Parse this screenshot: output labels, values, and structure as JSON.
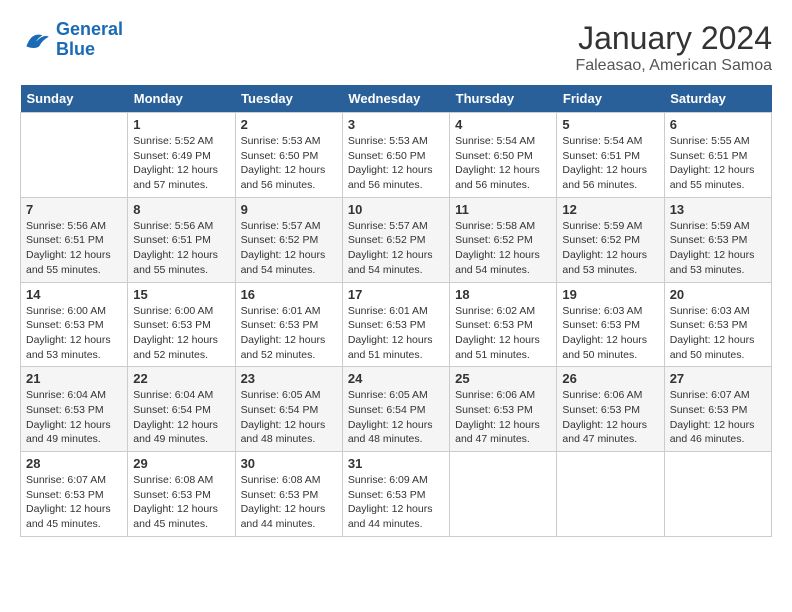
{
  "header": {
    "logo_line1": "General",
    "logo_line2": "Blue",
    "month": "January 2024",
    "location": "Faleasao, American Samoa"
  },
  "days_of_week": [
    "Sunday",
    "Monday",
    "Tuesday",
    "Wednesday",
    "Thursday",
    "Friday",
    "Saturday"
  ],
  "weeks": [
    [
      {
        "day": "",
        "sunrise": "",
        "sunset": "",
        "daylight": ""
      },
      {
        "day": "1",
        "sunrise": "Sunrise: 5:52 AM",
        "sunset": "Sunset: 6:49 PM",
        "daylight": "Daylight: 12 hours and 57 minutes."
      },
      {
        "day": "2",
        "sunrise": "Sunrise: 5:53 AM",
        "sunset": "Sunset: 6:50 PM",
        "daylight": "Daylight: 12 hours and 56 minutes."
      },
      {
        "day": "3",
        "sunrise": "Sunrise: 5:53 AM",
        "sunset": "Sunset: 6:50 PM",
        "daylight": "Daylight: 12 hours and 56 minutes."
      },
      {
        "day": "4",
        "sunrise": "Sunrise: 5:54 AM",
        "sunset": "Sunset: 6:50 PM",
        "daylight": "Daylight: 12 hours and 56 minutes."
      },
      {
        "day": "5",
        "sunrise": "Sunrise: 5:54 AM",
        "sunset": "Sunset: 6:51 PM",
        "daylight": "Daylight: 12 hours and 56 minutes."
      },
      {
        "day": "6",
        "sunrise": "Sunrise: 5:55 AM",
        "sunset": "Sunset: 6:51 PM",
        "daylight": "Daylight: 12 hours and 55 minutes."
      }
    ],
    [
      {
        "day": "7",
        "sunrise": "Sunrise: 5:56 AM",
        "sunset": "Sunset: 6:51 PM",
        "daylight": "Daylight: 12 hours and 55 minutes."
      },
      {
        "day": "8",
        "sunrise": "Sunrise: 5:56 AM",
        "sunset": "Sunset: 6:51 PM",
        "daylight": "Daylight: 12 hours and 55 minutes."
      },
      {
        "day": "9",
        "sunrise": "Sunrise: 5:57 AM",
        "sunset": "Sunset: 6:52 PM",
        "daylight": "Daylight: 12 hours and 54 minutes."
      },
      {
        "day": "10",
        "sunrise": "Sunrise: 5:57 AM",
        "sunset": "Sunset: 6:52 PM",
        "daylight": "Daylight: 12 hours and 54 minutes."
      },
      {
        "day": "11",
        "sunrise": "Sunrise: 5:58 AM",
        "sunset": "Sunset: 6:52 PM",
        "daylight": "Daylight: 12 hours and 54 minutes."
      },
      {
        "day": "12",
        "sunrise": "Sunrise: 5:59 AM",
        "sunset": "Sunset: 6:52 PM",
        "daylight": "Daylight: 12 hours and 53 minutes."
      },
      {
        "day": "13",
        "sunrise": "Sunrise: 5:59 AM",
        "sunset": "Sunset: 6:53 PM",
        "daylight": "Daylight: 12 hours and 53 minutes."
      }
    ],
    [
      {
        "day": "14",
        "sunrise": "Sunrise: 6:00 AM",
        "sunset": "Sunset: 6:53 PM",
        "daylight": "Daylight: 12 hours and 53 minutes."
      },
      {
        "day": "15",
        "sunrise": "Sunrise: 6:00 AM",
        "sunset": "Sunset: 6:53 PM",
        "daylight": "Daylight: 12 hours and 52 minutes."
      },
      {
        "day": "16",
        "sunrise": "Sunrise: 6:01 AM",
        "sunset": "Sunset: 6:53 PM",
        "daylight": "Daylight: 12 hours and 52 minutes."
      },
      {
        "day": "17",
        "sunrise": "Sunrise: 6:01 AM",
        "sunset": "Sunset: 6:53 PM",
        "daylight": "Daylight: 12 hours and 51 minutes."
      },
      {
        "day": "18",
        "sunrise": "Sunrise: 6:02 AM",
        "sunset": "Sunset: 6:53 PM",
        "daylight": "Daylight: 12 hours and 51 minutes."
      },
      {
        "day": "19",
        "sunrise": "Sunrise: 6:03 AM",
        "sunset": "Sunset: 6:53 PM",
        "daylight": "Daylight: 12 hours and 50 minutes."
      },
      {
        "day": "20",
        "sunrise": "Sunrise: 6:03 AM",
        "sunset": "Sunset: 6:53 PM",
        "daylight": "Daylight: 12 hours and 50 minutes."
      }
    ],
    [
      {
        "day": "21",
        "sunrise": "Sunrise: 6:04 AM",
        "sunset": "Sunset: 6:53 PM",
        "daylight": "Daylight: 12 hours and 49 minutes."
      },
      {
        "day": "22",
        "sunrise": "Sunrise: 6:04 AM",
        "sunset": "Sunset: 6:54 PM",
        "daylight": "Daylight: 12 hours and 49 minutes."
      },
      {
        "day": "23",
        "sunrise": "Sunrise: 6:05 AM",
        "sunset": "Sunset: 6:54 PM",
        "daylight": "Daylight: 12 hours and 48 minutes."
      },
      {
        "day": "24",
        "sunrise": "Sunrise: 6:05 AM",
        "sunset": "Sunset: 6:54 PM",
        "daylight": "Daylight: 12 hours and 48 minutes."
      },
      {
        "day": "25",
        "sunrise": "Sunrise: 6:06 AM",
        "sunset": "Sunset: 6:53 PM",
        "daylight": "Daylight: 12 hours and 47 minutes."
      },
      {
        "day": "26",
        "sunrise": "Sunrise: 6:06 AM",
        "sunset": "Sunset: 6:53 PM",
        "daylight": "Daylight: 12 hours and 47 minutes."
      },
      {
        "day": "27",
        "sunrise": "Sunrise: 6:07 AM",
        "sunset": "Sunset: 6:53 PM",
        "daylight": "Daylight: 12 hours and 46 minutes."
      }
    ],
    [
      {
        "day": "28",
        "sunrise": "Sunrise: 6:07 AM",
        "sunset": "Sunset: 6:53 PM",
        "daylight": "Daylight: 12 hours and 45 minutes."
      },
      {
        "day": "29",
        "sunrise": "Sunrise: 6:08 AM",
        "sunset": "Sunset: 6:53 PM",
        "daylight": "Daylight: 12 hours and 45 minutes."
      },
      {
        "day": "30",
        "sunrise": "Sunrise: 6:08 AM",
        "sunset": "Sunset: 6:53 PM",
        "daylight": "Daylight: 12 hours and 44 minutes."
      },
      {
        "day": "31",
        "sunrise": "Sunrise: 6:09 AM",
        "sunset": "Sunset: 6:53 PM",
        "daylight": "Daylight: 12 hours and 44 minutes."
      },
      {
        "day": "",
        "sunrise": "",
        "sunset": "",
        "daylight": ""
      },
      {
        "day": "",
        "sunrise": "",
        "sunset": "",
        "daylight": ""
      },
      {
        "day": "",
        "sunrise": "",
        "sunset": "",
        "daylight": ""
      }
    ]
  ]
}
